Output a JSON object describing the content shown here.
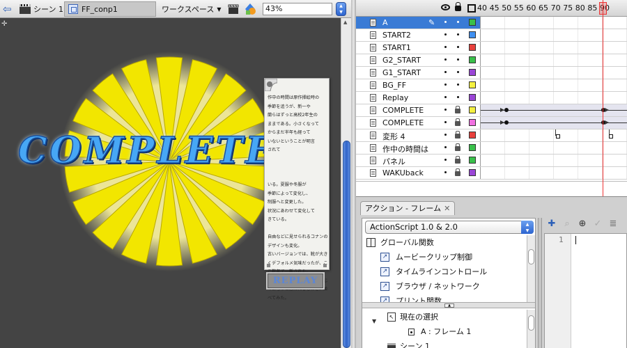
{
  "editbar": {
    "scene_label": "シーン 1",
    "symbol_label": "FF_conp1",
    "workspace_label": "ワークスペース",
    "zoom_value": "43%"
  },
  "stage": {
    "headline": "COMPLETE!",
    "burst_color": "#f2e600",
    "note_text": [
      "作中の時間は原作挿絵時の",
      "季節を追うが、新一や",
      "蘭らはずっと高校2年生の",
      "ままである。小さくなって",
      "からまだ半年も経って",
      "いないということが明言",
      "されて",
      "",
      "",
      "",
      "いる。夏服や冬服が",
      "季節によって変化し、",
      "制服へと変更した。",
      "状況にあわせて変化して",
      "きている。",
      "",
      "自由などに見せられるコナンのデザインも変化。",
      "古いバージョンでは、靴が大きくデフォルメ気味だったが、ここ数年で一新された。",
      "左が旧、右が新。おそらく同じであろうと思われるものを、並べてみた。"
    ],
    "replay_label": "REPLAY"
  },
  "timeline": {
    "ruler_ticks": [
      "40",
      "45",
      "50",
      "55",
      "60",
      "65",
      "70",
      "75",
      "80",
      "85",
      "90"
    ],
    "layers": [
      {
        "name": "A",
        "color": "#39c04a",
        "locked": false,
        "selected": true
      },
      {
        "name": "START2",
        "color": "#3f8ff0",
        "locked": false,
        "selected": false
      },
      {
        "name": "START1",
        "color": "#e8403c",
        "locked": false,
        "selected": false
      },
      {
        "name": "G2_START",
        "color": "#39c04a",
        "locked": false,
        "selected": false
      },
      {
        "name": "G1_START",
        "color": "#9a45d6",
        "locked": false,
        "selected": false
      },
      {
        "name": "BG_FF",
        "color": "#f4f040",
        "locked": false,
        "selected": false
      },
      {
        "name": "Replay",
        "color": "#9a45d6",
        "locked": false,
        "selected": false
      },
      {
        "name": "COMPLETE",
        "color": "#f4f040",
        "locked": true,
        "selected": false
      },
      {
        "name": "COMPLETE",
        "color": "#f070e0",
        "locked": true,
        "selected": false
      },
      {
        "name": "変形 4",
        "color": "#e8403c",
        "locked": true,
        "selected": false
      },
      {
        "name": "作中の時間は",
        "color": "#39c04a",
        "locked": true,
        "selected": false
      },
      {
        "name": "パネル",
        "color": "#39c04a",
        "locked": true,
        "selected": false
      },
      {
        "name": "WAKUback",
        "color": "#9a45d6",
        "locked": true,
        "selected": false
      }
    ]
  },
  "actions": {
    "tab_label": "アクション - フレーム",
    "language_select": "ActionScript 1.0 & 2.0",
    "toolbox": [
      {
        "label": "グローバル関数",
        "kind": "book"
      },
      {
        "label": "ムービークリップ制御",
        "kind": "fn"
      },
      {
        "label": "タイムラインコントロール",
        "kind": "fn"
      },
      {
        "label": "ブラウザ / ネットワーク",
        "kind": "fn"
      },
      {
        "label": "プリント関数",
        "kind": "fn"
      }
    ],
    "script_nav": [
      {
        "label": "現在の選択",
        "kind": "select"
      },
      {
        "label": "A : フレーム 1",
        "kind": "frame"
      },
      {
        "label": "シーン 1",
        "kind": "scene"
      }
    ],
    "line_number": "1"
  }
}
